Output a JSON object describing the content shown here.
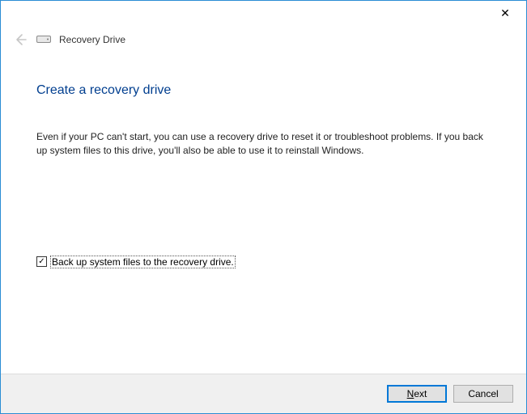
{
  "titlebar": {
    "close_glyph": "✕"
  },
  "header": {
    "back_icon": "←",
    "title": "Recovery Drive"
  },
  "page": {
    "heading": "Create a recovery drive",
    "description": "Even if your PC can't start, you can use a recovery drive to reset it or troubleshoot problems. If you back up system files to this drive, you'll also be able to use it to reinstall Windows."
  },
  "option": {
    "checked_glyph": "✓",
    "label": "Back up system files to the recovery drive."
  },
  "footer": {
    "next_prefix": "N",
    "next_rest": "ext",
    "cancel": "Cancel"
  }
}
